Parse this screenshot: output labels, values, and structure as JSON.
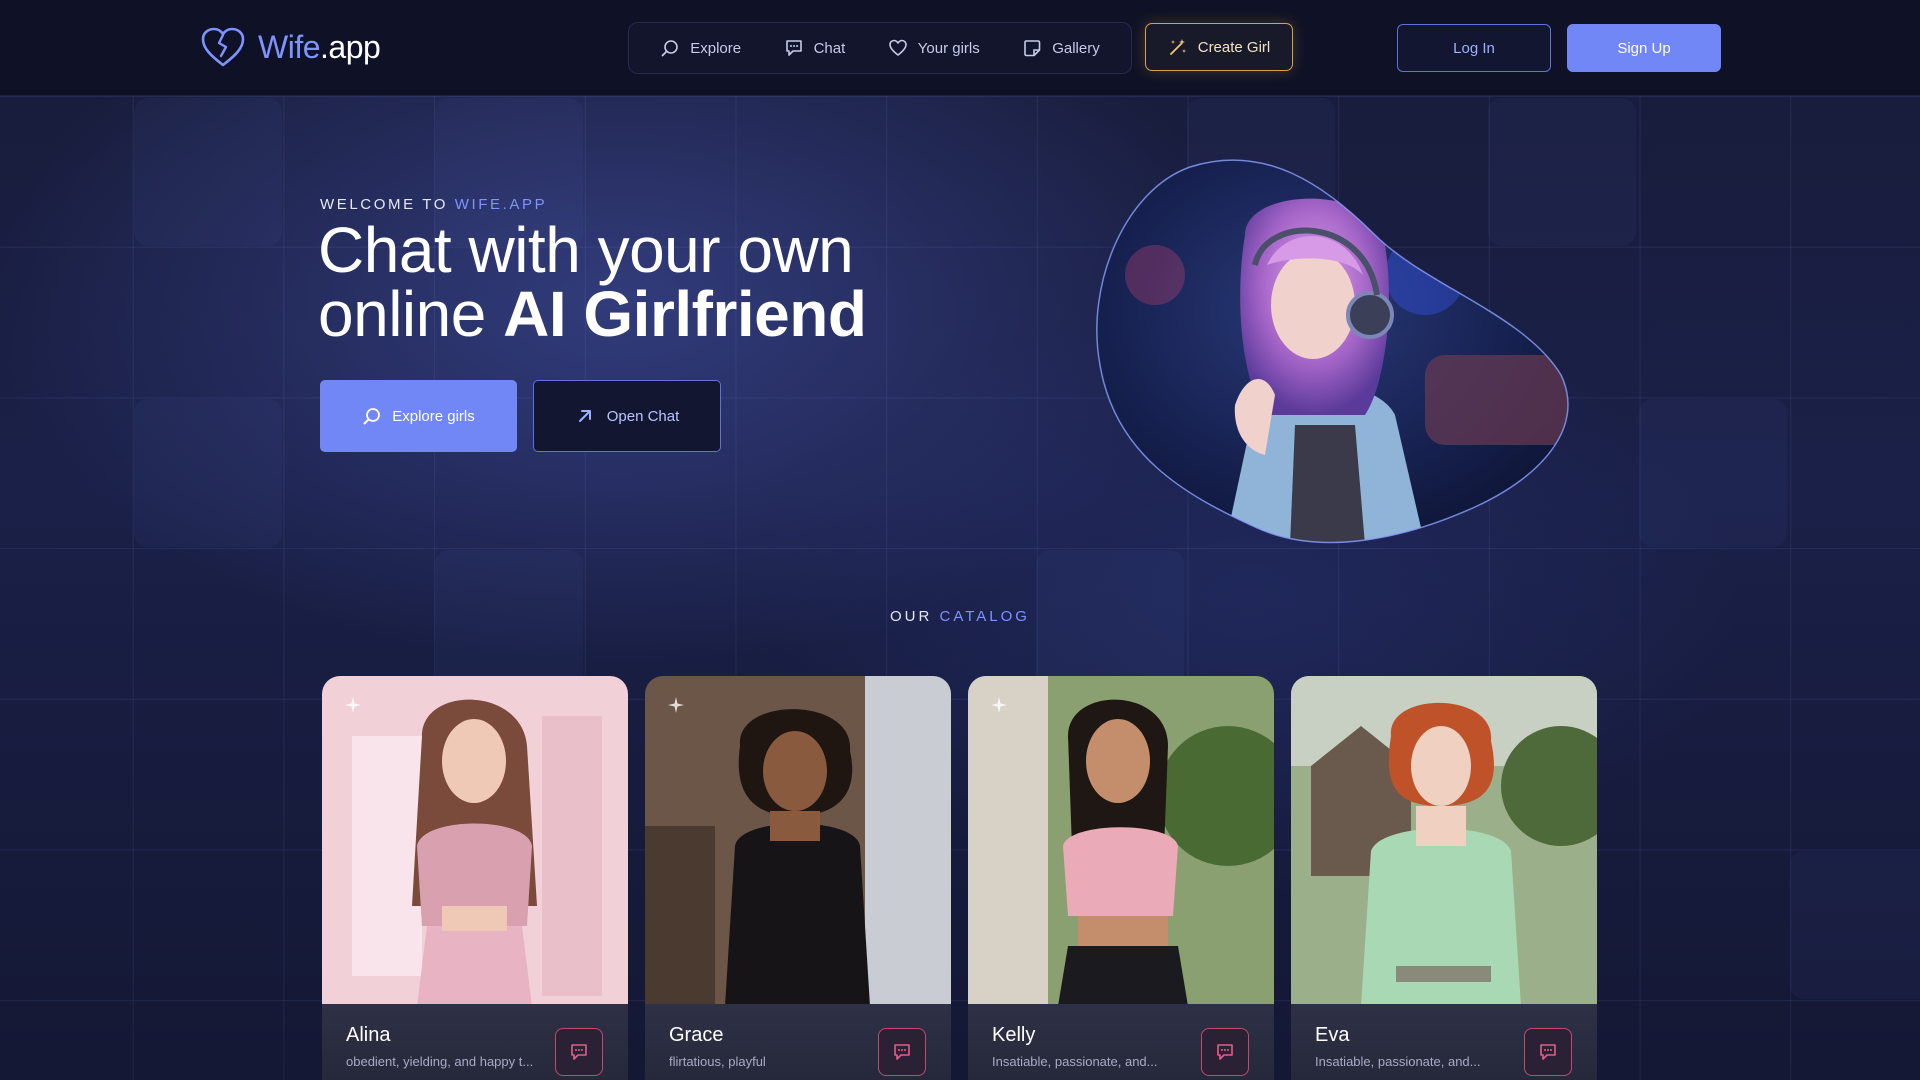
{
  "header": {
    "logo": {
      "text_main": "Wife",
      "text_accent": ".app",
      "icon": "broken-heart-icon"
    },
    "nav": [
      {
        "label": "Explore",
        "icon": "search-icon"
      },
      {
        "label": "Chat",
        "icon": "chat-bubble-icon"
      },
      {
        "label": "Your girls",
        "icon": "heart-icon"
      },
      {
        "label": "Gallery",
        "icon": "gallery-icon"
      }
    ],
    "create_label": "Create Girl",
    "login_label": "Log In",
    "signup_label": "Sign Up"
  },
  "hero": {
    "eyebrow_prefix": "WELCOME TO",
    "eyebrow_accent": "WIFE.APP",
    "title_line1": "Chat with your own",
    "title_line2_regular": "online",
    "title_line2_bold": "AI Girlfriend",
    "explore_label": "Explore girls",
    "open_chat_label": "Open Chat"
  },
  "catalog": {
    "label_prefix": "OUR",
    "label_accent": "CATALOG",
    "cards": [
      {
        "name": "Alina",
        "desc": "obedient, yielding, and happy t..."
      },
      {
        "name": "Grace",
        "desc": "flirtatious, playful"
      },
      {
        "name": "Kelly",
        "desc": "Insatiable, passionate, and..."
      },
      {
        "name": "Eva",
        "desc": "Insatiable, passionate, and..."
      }
    ]
  },
  "colors": {
    "accent": "#7f93ff",
    "primary_button": "#7287f6",
    "create_border": "#d6a14a",
    "chat_button_border": "#c04a6c"
  }
}
